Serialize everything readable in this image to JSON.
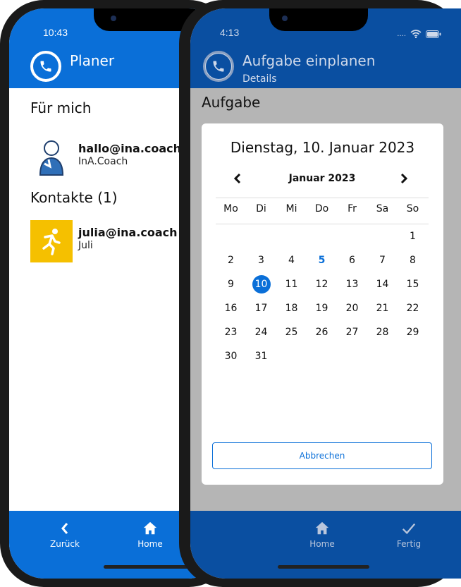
{
  "back_screen": {
    "time": "10:43",
    "header": {
      "title": "Planer",
      "logo_icon": "phone-icon"
    },
    "sections": {
      "mine": "Für mich",
      "contacts": "Kontakte (1)"
    },
    "contacts_mine": [
      {
        "email": "hallo@ina.coach",
        "name": "InA.Coach",
        "avatar_icon": "coach-avatar-icon"
      }
    ],
    "contacts_list": [
      {
        "email": "julia@ina.coach",
        "name": "Juli",
        "avatar_icon": "running-person-icon"
      }
    ],
    "bottom_nav": {
      "back_label": "Zurück",
      "home_label": "Home"
    }
  },
  "front_screen": {
    "time": "4:13",
    "header": {
      "title": "Aufgabe einplanen",
      "subtitle": "Details",
      "logo_icon": "phone-icon"
    },
    "overlay_label": "Aufgabe",
    "dialog": {
      "title": "Dienstag, 10. Januar 2023",
      "month_label": "Januar 2023",
      "prev_icon": "chevron-left-icon",
      "next_icon": "chevron-right-icon",
      "weekdays": [
        "Mo",
        "Di",
        "Mi",
        "Do",
        "Fr",
        "Sa",
        "So"
      ],
      "selected_day": "10",
      "today_day": "5",
      "weeks": [
        [
          "",
          "",
          "",
          "",
          "",
          "",
          "1"
        ],
        [
          "2",
          "3",
          "4",
          "5",
          "6",
          "7",
          "8"
        ],
        [
          "9",
          "10",
          "11",
          "12",
          "13",
          "14",
          "15"
        ],
        [
          "16",
          "17",
          "18",
          "19",
          "20",
          "21",
          "22"
        ],
        [
          "23",
          "24",
          "25",
          "26",
          "27",
          "28",
          "29"
        ],
        [
          "30",
          "31",
          "",
          "",
          "",
          "",
          ""
        ]
      ],
      "cancel_label": "Abbrechen"
    },
    "bottom_nav": {
      "home_label": "Home",
      "done_label": "Fertig"
    }
  },
  "colors": {
    "primary": "#0a6fd8",
    "primary_dark": "#0a4fa1",
    "accent_yellow": "#f5c000",
    "overlay": "#b5b5b5"
  }
}
